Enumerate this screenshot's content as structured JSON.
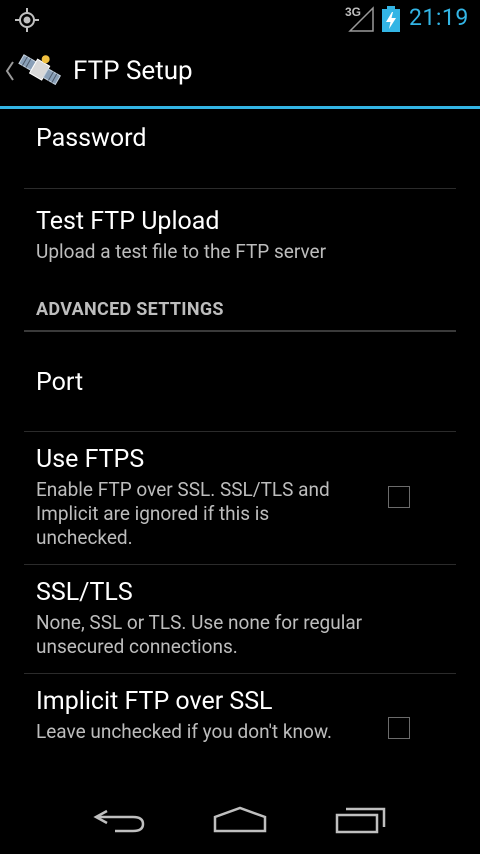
{
  "status": {
    "network": "3G",
    "time": "21:19",
    "icons": [
      "gps-icon",
      "signal-icon",
      "battery-charging-icon"
    ],
    "accent": "#33b5e5"
  },
  "actionbar": {
    "title": "FTP Setup",
    "icon": "satellite-icon"
  },
  "preferences": {
    "password": {
      "title": "Password"
    },
    "test_upload": {
      "title": "Test FTP Upload",
      "summary": "Upload a test file to the FTP server"
    },
    "section_advanced": "ADVANCED SETTINGS",
    "port": {
      "title": "Port"
    },
    "use_ftps": {
      "title": "Use FTPS",
      "summary": "Enable FTP over SSL. SSL/TLS and Implicit are ignored if this is unchecked.",
      "checked": false
    },
    "ssl_tls": {
      "title": "SSL/TLS",
      "summary": "None, SSL or TLS. Use none for regular unsecured connections."
    },
    "implicit": {
      "title": "Implicit FTP over SSL",
      "summary": "Leave unchecked if you don't know.",
      "checked": false
    }
  },
  "navbar": {
    "buttons": [
      "back-icon",
      "home-icon",
      "recent-apps-icon"
    ]
  }
}
